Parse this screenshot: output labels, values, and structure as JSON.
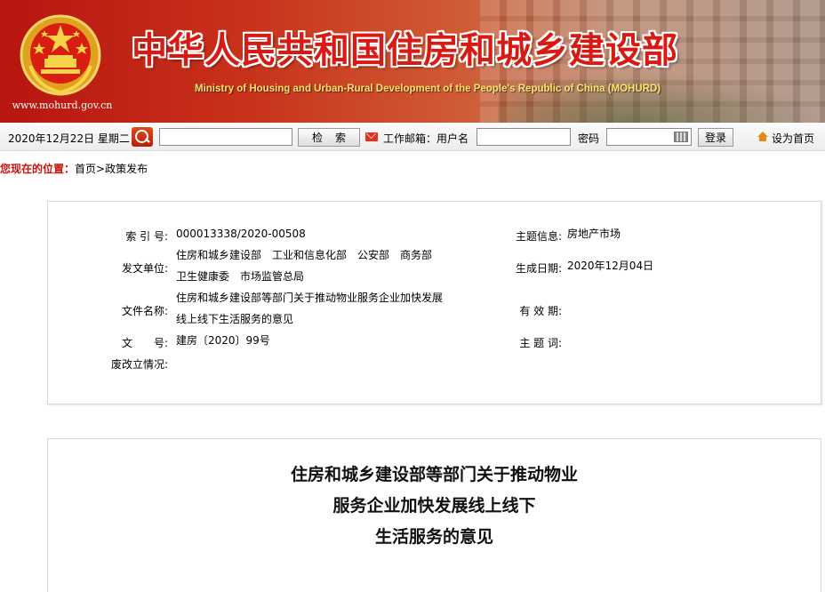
{
  "header": {
    "title": "中华人民共和国住房和城乡建设部",
    "subtitle": "Ministry of Housing and Urban-Rural Development of the People's Republic of China (MOHURD)",
    "domain": "www.mohurd.gov.cn",
    "emblem_icon": "national-emblem-icon"
  },
  "toolbar": {
    "date": "2020年12月22日 星期二",
    "search_value": "",
    "search_button": "检索",
    "mail_label": "工作邮箱：用户名",
    "username_value": "",
    "password_label": "密码",
    "password_value": "",
    "login_button": "登录",
    "home_label": "设为首页"
  },
  "breadcrumb": {
    "location_label": "您现在的位置：",
    "path": "首页>政策发布"
  },
  "meta": {
    "index_label": "索 引 号:",
    "index_value": "000013338/2020-00508",
    "publisher_label": "发文单位:",
    "publisher_line1": "住房和城乡建设部　工业和信息化部　公安部　商务部",
    "publisher_line2": "卫生健康委　市场监管总局",
    "doc_name_label": "文件名称:",
    "doc_name_line1": "住房和城乡建设部等部门关于推动物业服务企业加快发展",
    "doc_name_line2": "线上线下生活服务的意见",
    "doc_no_label": "文　　号:",
    "doc_no_value": "建房〔2020〕99号",
    "status_label": "废改立情况:",
    "status_value": "",
    "topic_label": "主题信息:",
    "topic_value": "房地产市场",
    "date_label": "生成日期:",
    "date_value": "2020年12月04日",
    "valid_label": "有 效 期:",
    "valid_value": "",
    "keywords_label": "主 题 词:",
    "keywords_value": ""
  },
  "article": {
    "title_line1": "住房和城乡建设部等部门关于推动物业",
    "title_line2": "服务企业加快发展线上线下",
    "title_line3": "生活服务的意见"
  },
  "colors": {
    "brand_red": "#d71a14",
    "location_red": "#c8140c",
    "subtitle_yellow": "#ffe36a"
  }
}
